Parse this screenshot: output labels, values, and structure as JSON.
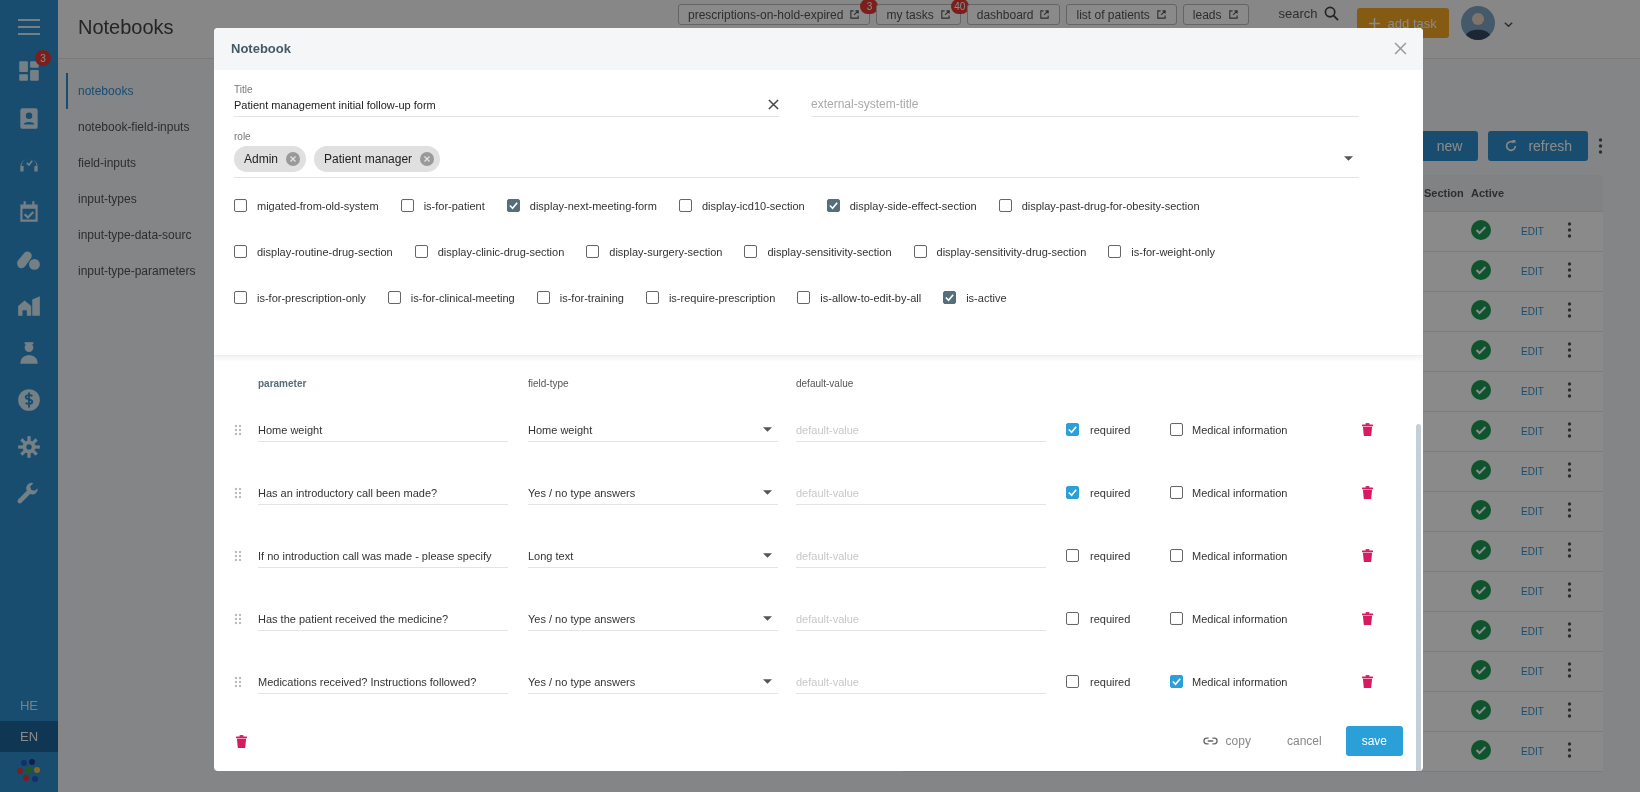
{
  "sidebar": {
    "items": [
      {
        "kind": "dashboard",
        "badge": "3"
      },
      {
        "kind": "contact"
      },
      {
        "kind": "headset"
      },
      {
        "kind": "calendar"
      },
      {
        "kind": "pills"
      },
      {
        "kind": "buildings"
      },
      {
        "kind": "doctor"
      },
      {
        "kind": "dollar"
      },
      {
        "kind": "gear"
      },
      {
        "kind": "wrench"
      }
    ],
    "languages": [
      {
        "label": "HE",
        "selected": false
      },
      {
        "label": "EN",
        "selected": true
      }
    ]
  },
  "header": {
    "title": "Notebooks",
    "links": [
      {
        "label": "prescriptions-on-hold-expired",
        "badge": "3"
      },
      {
        "label": "my tasks",
        "badge": "40"
      },
      {
        "label": "dashboard"
      },
      {
        "label": "list of patients"
      },
      {
        "label": "leads"
      }
    ],
    "search": "search",
    "add_task": "add task"
  },
  "subnav": [
    {
      "label": "notebooks",
      "selected": true
    },
    {
      "label": "notebook-field-inputs",
      "selected": false
    },
    {
      "label": "field-inputs",
      "selected": false
    },
    {
      "label": "input-types",
      "selected": false
    },
    {
      "label": "input-type-data-sourc",
      "selected": false
    },
    {
      "label": "input-type-parameters",
      "selected": false
    }
  ],
  "toolbar": {
    "new": "new",
    "refresh": "refresh"
  },
  "table": {
    "columns": [
      "Section",
      "Active"
    ],
    "rows": [
      {
        "active": true,
        "action": "EDIT"
      },
      {
        "active": true,
        "action": "EDIT"
      },
      {
        "active": true,
        "action": "EDIT"
      },
      {
        "active": true,
        "action": "EDIT"
      },
      {
        "active": true,
        "action": "EDIT"
      },
      {
        "active": true,
        "action": "EDIT"
      },
      {
        "active": true,
        "action": "EDIT"
      },
      {
        "active": true,
        "action": "EDIT"
      },
      {
        "active": true,
        "action": "EDIT"
      },
      {
        "active": true,
        "action": "EDIT"
      },
      {
        "active": true,
        "action": "EDIT"
      },
      {
        "active": true,
        "action": "EDIT"
      },
      {
        "active": true,
        "action": "EDIT"
      },
      {
        "active": true,
        "action": "EDIT"
      }
    ]
  },
  "dialog": {
    "title": "Notebook",
    "title_field": {
      "label": "Title",
      "value": "Patient management initial follow-up form"
    },
    "external_field": {
      "placeholder": "external-system-title"
    },
    "role": {
      "label": "role",
      "chips": [
        "Admin",
        "Patient manager"
      ]
    },
    "flags": [
      {
        "label": "migated-from-old-system",
        "checked": false
      },
      {
        "label": "is-for-patient",
        "checked": false
      },
      {
        "label": "display-next-meeting-form",
        "checked": true
      },
      {
        "label": "display-icd10-section",
        "checked": false
      },
      {
        "label": "display-side-effect-section",
        "checked": true
      },
      {
        "label": "display-past-drug-for-obesity-section",
        "checked": false
      },
      {
        "label": "display-routine-drug-section",
        "checked": false
      },
      {
        "label": "display-clinic-drug-section",
        "checked": false
      },
      {
        "label": "display-surgery-section",
        "checked": false
      },
      {
        "label": "display-sensitivity-section",
        "checked": false
      },
      {
        "label": "display-sensitivity-drug-section",
        "checked": false
      },
      {
        "label": "is-for-weight-only",
        "checked": false
      },
      {
        "label": "is-for-prescription-only",
        "checked": false
      },
      {
        "label": "is-for-clinical-meeting",
        "checked": false
      },
      {
        "label": "is-for-training",
        "checked": false
      },
      {
        "label": "is-require-prescription",
        "checked": false
      },
      {
        "label": "is-allow-to-edit-by-all",
        "checked": false
      },
      {
        "label": "is-active",
        "checked": true
      }
    ],
    "columns": [
      "parameter",
      "field-type",
      "default-value"
    ],
    "rows": [
      {
        "parameter": "Home weight",
        "field_type": "Home weight",
        "default_placeholder": "default-value",
        "required": true,
        "required_label": "required",
        "medical": false,
        "medical_label": "Medical information"
      },
      {
        "parameter": "Has an introductory call been made?",
        "field_type": "Yes / no type answers",
        "default_placeholder": "default-value",
        "required": true,
        "required_label": "required",
        "medical": false,
        "medical_label": "Medical information"
      },
      {
        "parameter": "If no introduction call was made - please specify",
        "field_type": "Long text",
        "default_placeholder": "default-value",
        "required": false,
        "required_label": "required",
        "medical": false,
        "medical_label": "Medical information"
      },
      {
        "parameter": "Has the patient received the medicine?",
        "field_type": "Yes / no type answers",
        "default_placeholder": "default-value",
        "required": false,
        "required_label": "required",
        "medical": false,
        "medical_label": "Medical information"
      },
      {
        "parameter": "Medications received? Instructions followed?",
        "field_type": "Yes / no type answers",
        "default_placeholder": "default-value",
        "required": false,
        "required_label": "required",
        "medical": true,
        "medical_label": "Medical information"
      }
    ],
    "footer": {
      "copy": "copy",
      "cancel": "cancel",
      "save": "save"
    }
  }
}
